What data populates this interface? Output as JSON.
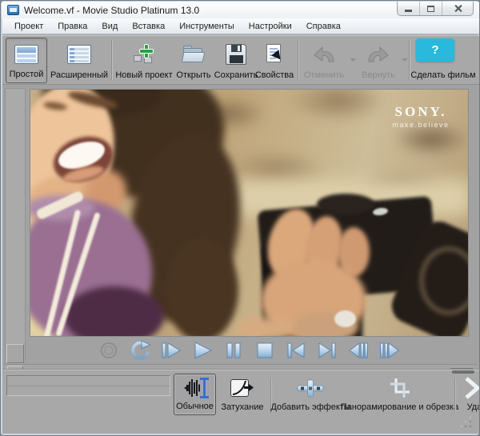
{
  "window": {
    "title": "Welcome.vf - Movie Studio Platinum 13.0",
    "controls": [
      "minimize",
      "maximize",
      "close"
    ]
  },
  "menu": {
    "items": [
      "Проект",
      "Правка",
      "Вид",
      "Вставка",
      "Инструменты",
      "Настройки",
      "Справка"
    ]
  },
  "toolbar": {
    "view_simple": "Простой",
    "view_advanced": "Расширенный",
    "new_project": "Новый проект",
    "open": "Открыть",
    "save": "Сохранить",
    "properties": "Свойства",
    "undo": "Отменить",
    "redo": "Вернуть",
    "make_movie": "Сделать фильм",
    "help_bubble": "?",
    "help_bubble_color": "#29b9dc",
    "selected_view": "Простой",
    "disabled_buttons": [
      "Отменить",
      "Вернуть"
    ]
  },
  "video": {
    "watermark_line1": "SONY.",
    "watermark_line2": "make.believe"
  },
  "transport": {
    "buttons": [
      "record",
      "loop",
      "play-from-start",
      "play",
      "pause",
      "stop",
      "go-to-start",
      "go-to-end",
      "previous-frame",
      "next-frame"
    ],
    "icon_color": "#9cbcd9",
    "record_disabled": true
  },
  "bottom_toolbar": {
    "normal": "Обычное",
    "fade": "Затухание",
    "add_effects": "Добавить эффекты",
    "pan_crop": "Панорамирование и обрезка",
    "delete_partial": "Уда",
    "selected": "Обычное"
  }
}
